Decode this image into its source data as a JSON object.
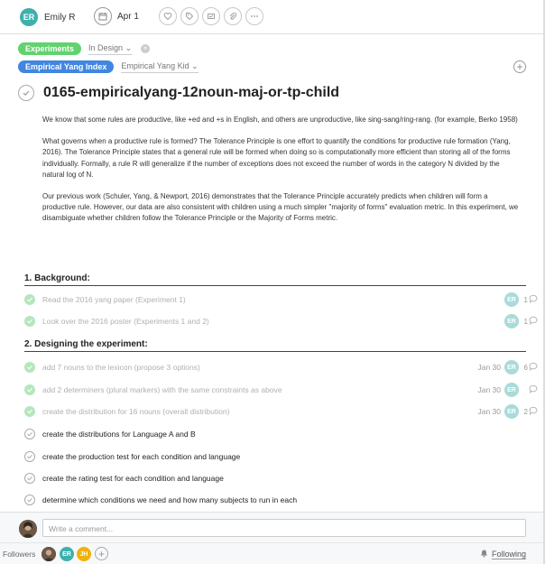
{
  "header": {
    "assignee_initials": "ER",
    "assignee_name": "Emily R",
    "due_date": "Apr 1"
  },
  "tags": {
    "project1": "Experiments",
    "section1": "In Design",
    "project2": "Empirical Yang Index",
    "section2": "Empirical Yang Kid"
  },
  "task": {
    "title": "0165-empiricalyang-12noun-maj-or-tp-child",
    "desc_p1": "We know that some rules are productive, like +ed and +s in English, and others are unproductive, like sing-sang/ring-rang.  (for example, Berko 1958)",
    "desc_p2": "What governs when a productive rule is formed?  The Tolerance Principle is one effort to quantify the conditions for productive rule formation (Yang, 2016).  The Tolerance Principle states that a general rule will be formed when doing so is computationally more efficient than storing all of the forms individually. Formally, a rule R will generalize if the number of exceptions does not exceed the number of words in the category N divided by the natural log of N.",
    "desc_p3": "Our previous work (Schuler, Yang, & Newport, 2016) demonstrates that the Tolerance Principle accurately predicts when children will form a productive rule.  However, our data are also consistent with children using a much simpler \"majority of forms\" evaluation metric.  In this experiment, we disambiguate whether children follow the Tolerance Principle or the Majority of Forms metric."
  },
  "sections": [
    {
      "title": "1. Background:"
    },
    {
      "title": "2. Designing the experiment:"
    }
  ],
  "subtasks": [
    {
      "name": "Read the 2016 yang paper (Experiment 1)",
      "due": "",
      "assignee": "ER",
      "comments": "1"
    },
    {
      "name": "Look over the 2016 poster (Experiments 1 and 2)",
      "due": "",
      "assignee": "ER",
      "comments": "1"
    },
    {
      "name": "add 7 nouns to the lexicon (propose 3 options)",
      "due": "Jan 30",
      "assignee": "ER",
      "comments": "6"
    },
    {
      "name": "add 2 determiners (plural markers) with the same constraints as above",
      "due": "Jan 30",
      "assignee": "ER",
      "comments": ""
    },
    {
      "name": "create the distribution for 16 nouns (overall distribution)",
      "due": "Jan 30",
      "assignee": "ER",
      "comments": "2"
    },
    {
      "name": "create the distributions for Language A and B",
      "due": "",
      "assignee": "",
      "comments": ""
    },
    {
      "name": "create the production test for each condition and language",
      "due": "",
      "assignee": "",
      "comments": ""
    },
    {
      "name": "create the rating test for each condition and language",
      "due": "",
      "assignee": "",
      "comments": ""
    },
    {
      "name": "determine which conditions we need and how many subjects to run in each",
      "due": "",
      "assignee": "",
      "comments": ""
    }
  ],
  "comment": {
    "placeholder": "Write a comment..."
  },
  "footer": {
    "followers_label": "Followers",
    "follower1": "ER",
    "follower2": "JH",
    "following_label": "Following"
  }
}
